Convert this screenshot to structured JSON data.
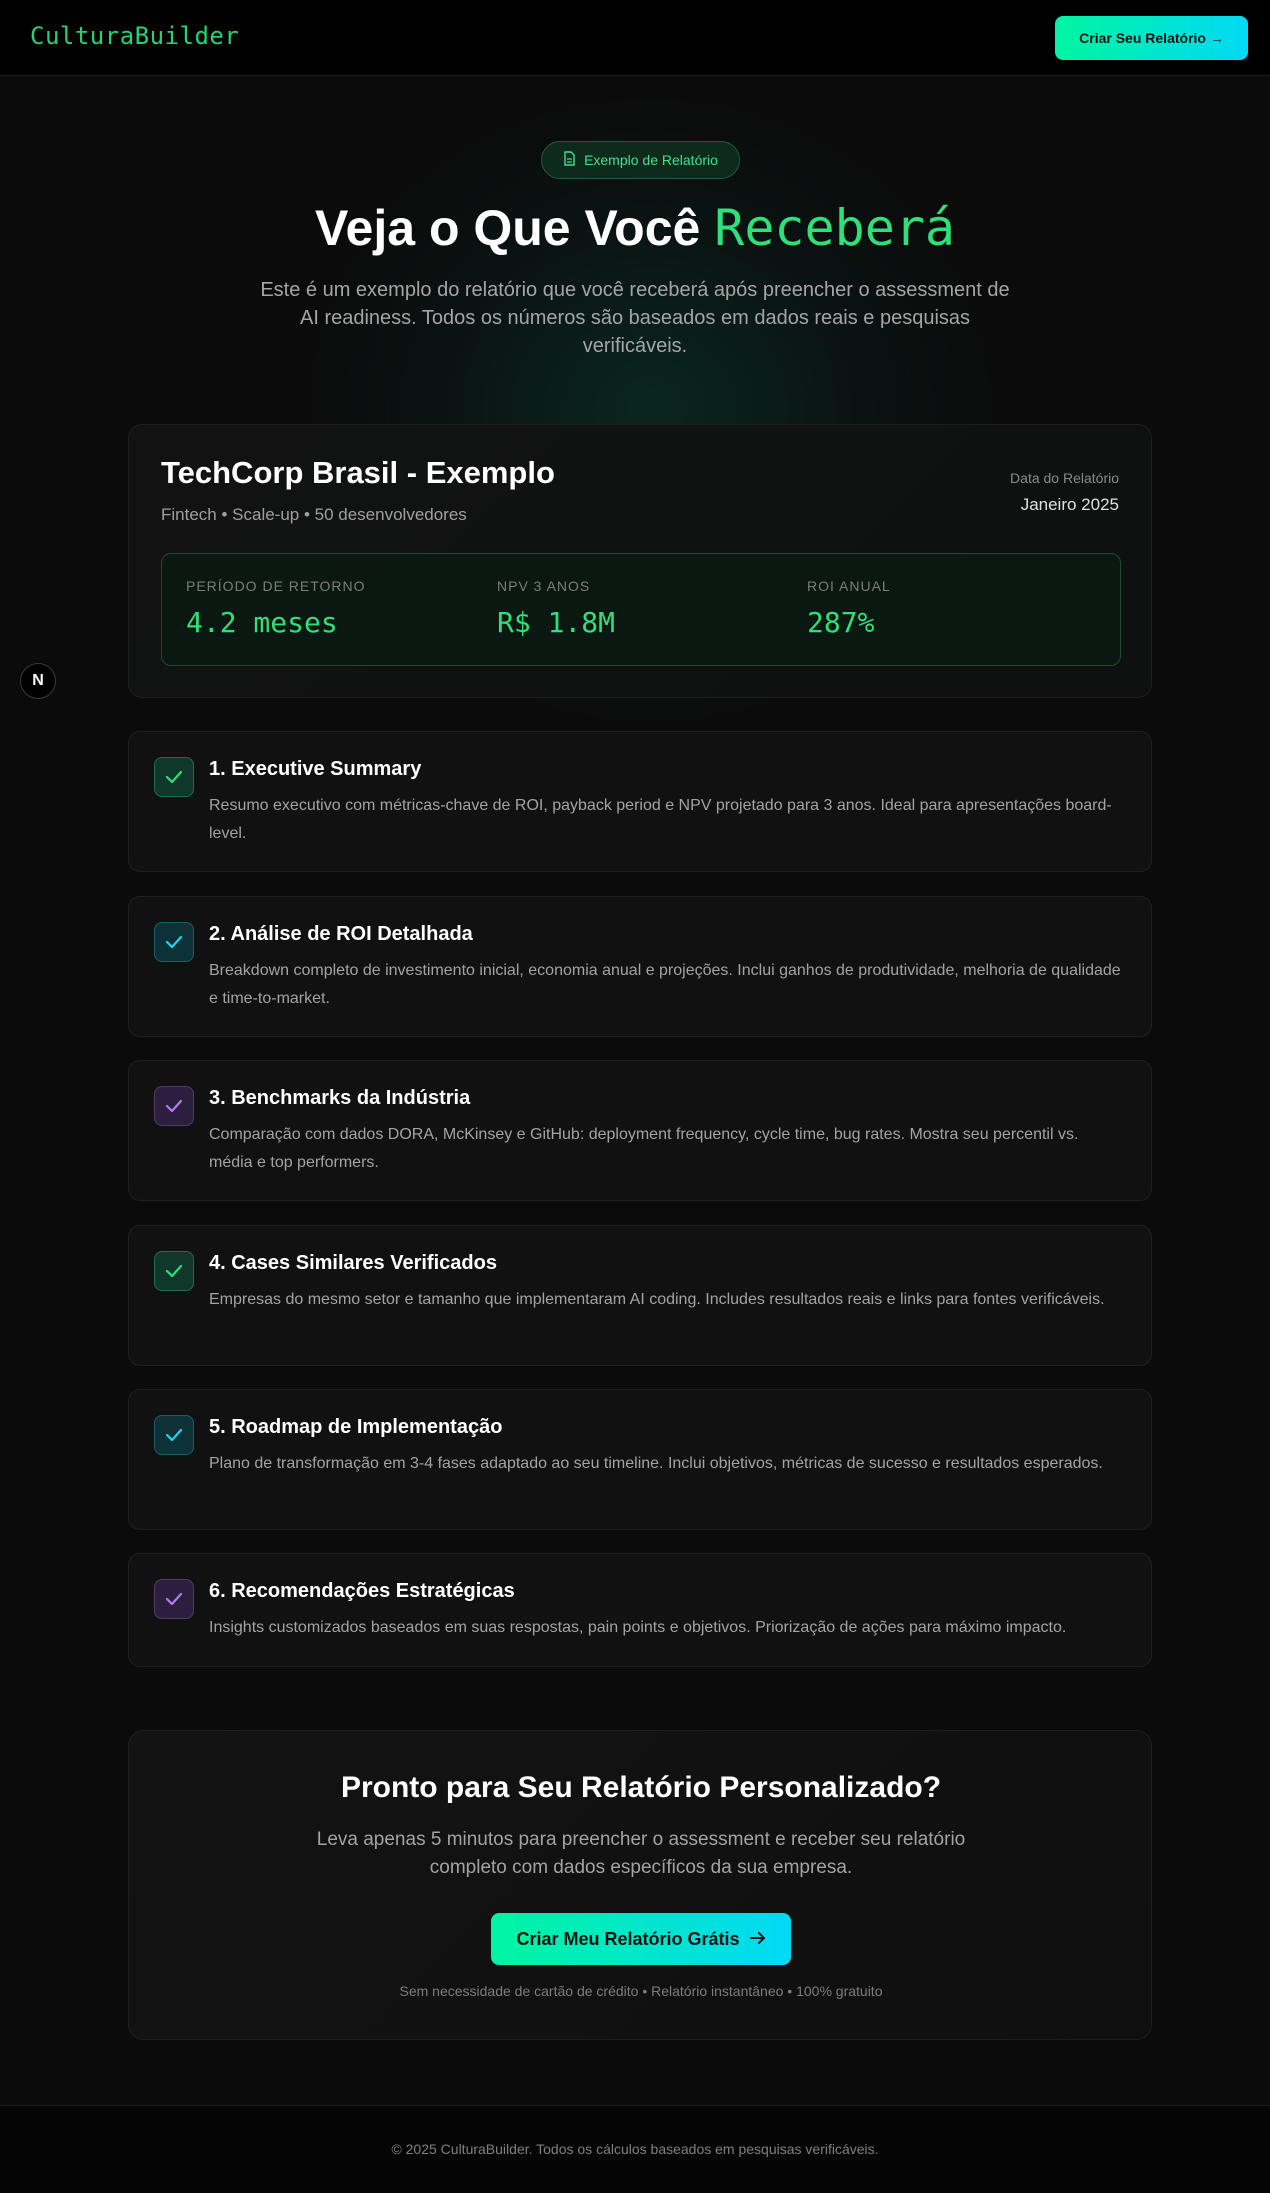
{
  "header": {
    "logo": "CulturaBuilder",
    "cta_label": "Criar Seu Relatório →"
  },
  "hero": {
    "badge_icon": "document-icon",
    "badge": "Exemplo de Relatório",
    "title_main": "Veja o Que Você",
    "title_accent": "Receberá",
    "subtitle": "Este é um exemplo do relatório que você receberá após preencher o assessment de AI readiness. Todos os números são baseados em dados reais e pesquisas verificáveis."
  },
  "report": {
    "company": "TechCorp Brasil - Exemplo",
    "meta": "Fintech • Scale-up • 50 desenvolvedores",
    "date_label": "Data do Relatório",
    "date_value": "Janeiro 2025",
    "metrics": [
      {
        "label": "PERÍODO DE RETORNO",
        "value": "4.2 meses"
      },
      {
        "label": "NPV 3 ANOS",
        "value": "R$ 1.8M"
      },
      {
        "label": "ROI ANUAL",
        "value": "287%"
      }
    ]
  },
  "sections": [
    {
      "title": "1. Executive Summary",
      "desc": "Resumo executivo com métricas-chave de ROI, payback period e NPV projetado para 3 anos. Ideal para apresentações board-level.",
      "color": "green"
    },
    {
      "title": "2. Análise de ROI Detalhada",
      "desc": "Breakdown completo de investimento inicial, economia anual e projeções. Inclui ganhos de produtividade, melhoria de qualidade e time-to-market.",
      "color": "cyan"
    },
    {
      "title": "3. Benchmarks da Indústria",
      "desc": "Comparação com dados DORA, McKinsey e GitHub: deployment frequency, cycle time, bug rates. Mostra seu percentil vs. média e top performers.",
      "color": "purple"
    },
    {
      "title": "4. Cases Similares Verificados",
      "desc": "Empresas do mesmo setor e tamanho que implementaram AI coding. Includes resultados reais e links para fontes verificáveis.",
      "color": "green"
    },
    {
      "title": "5. Roadmap de Implementação",
      "desc": "Plano de transformação em 3-4 fases adaptado ao seu timeline. Inclui objetivos, métricas de sucesso e resultados esperados.",
      "color": "cyan"
    },
    {
      "title": "6. Recomendações Estratégicas",
      "desc": "Insights customizados baseados em suas respostas, pain points e objetivos. Priorização de ações para máximo impacto.",
      "color": "purple"
    }
  ],
  "cta": {
    "title": "Pronto para Seu Relatório Personalizado?",
    "subtitle": "Leva apenas 5 minutos para preencher o assessment e receber seu relatório completo com dados específicos da sua empresa.",
    "button": "Criar Meu Relatório Grátis",
    "note": "Sem necessidade de cartão de crédito • Relatório instantâneo • 100% gratuito"
  },
  "footer": {
    "text": "© 2025 CulturaBuilder. Todos os cálculos baseados em pesquisas verificáveis."
  },
  "floating": {
    "label": "N"
  },
  "colors": {
    "accent_green": "#2ee07a",
    "accent_cyan": "#00d9f5",
    "accent_purple": "#b07cf0",
    "background": "#0b0b0b"
  }
}
